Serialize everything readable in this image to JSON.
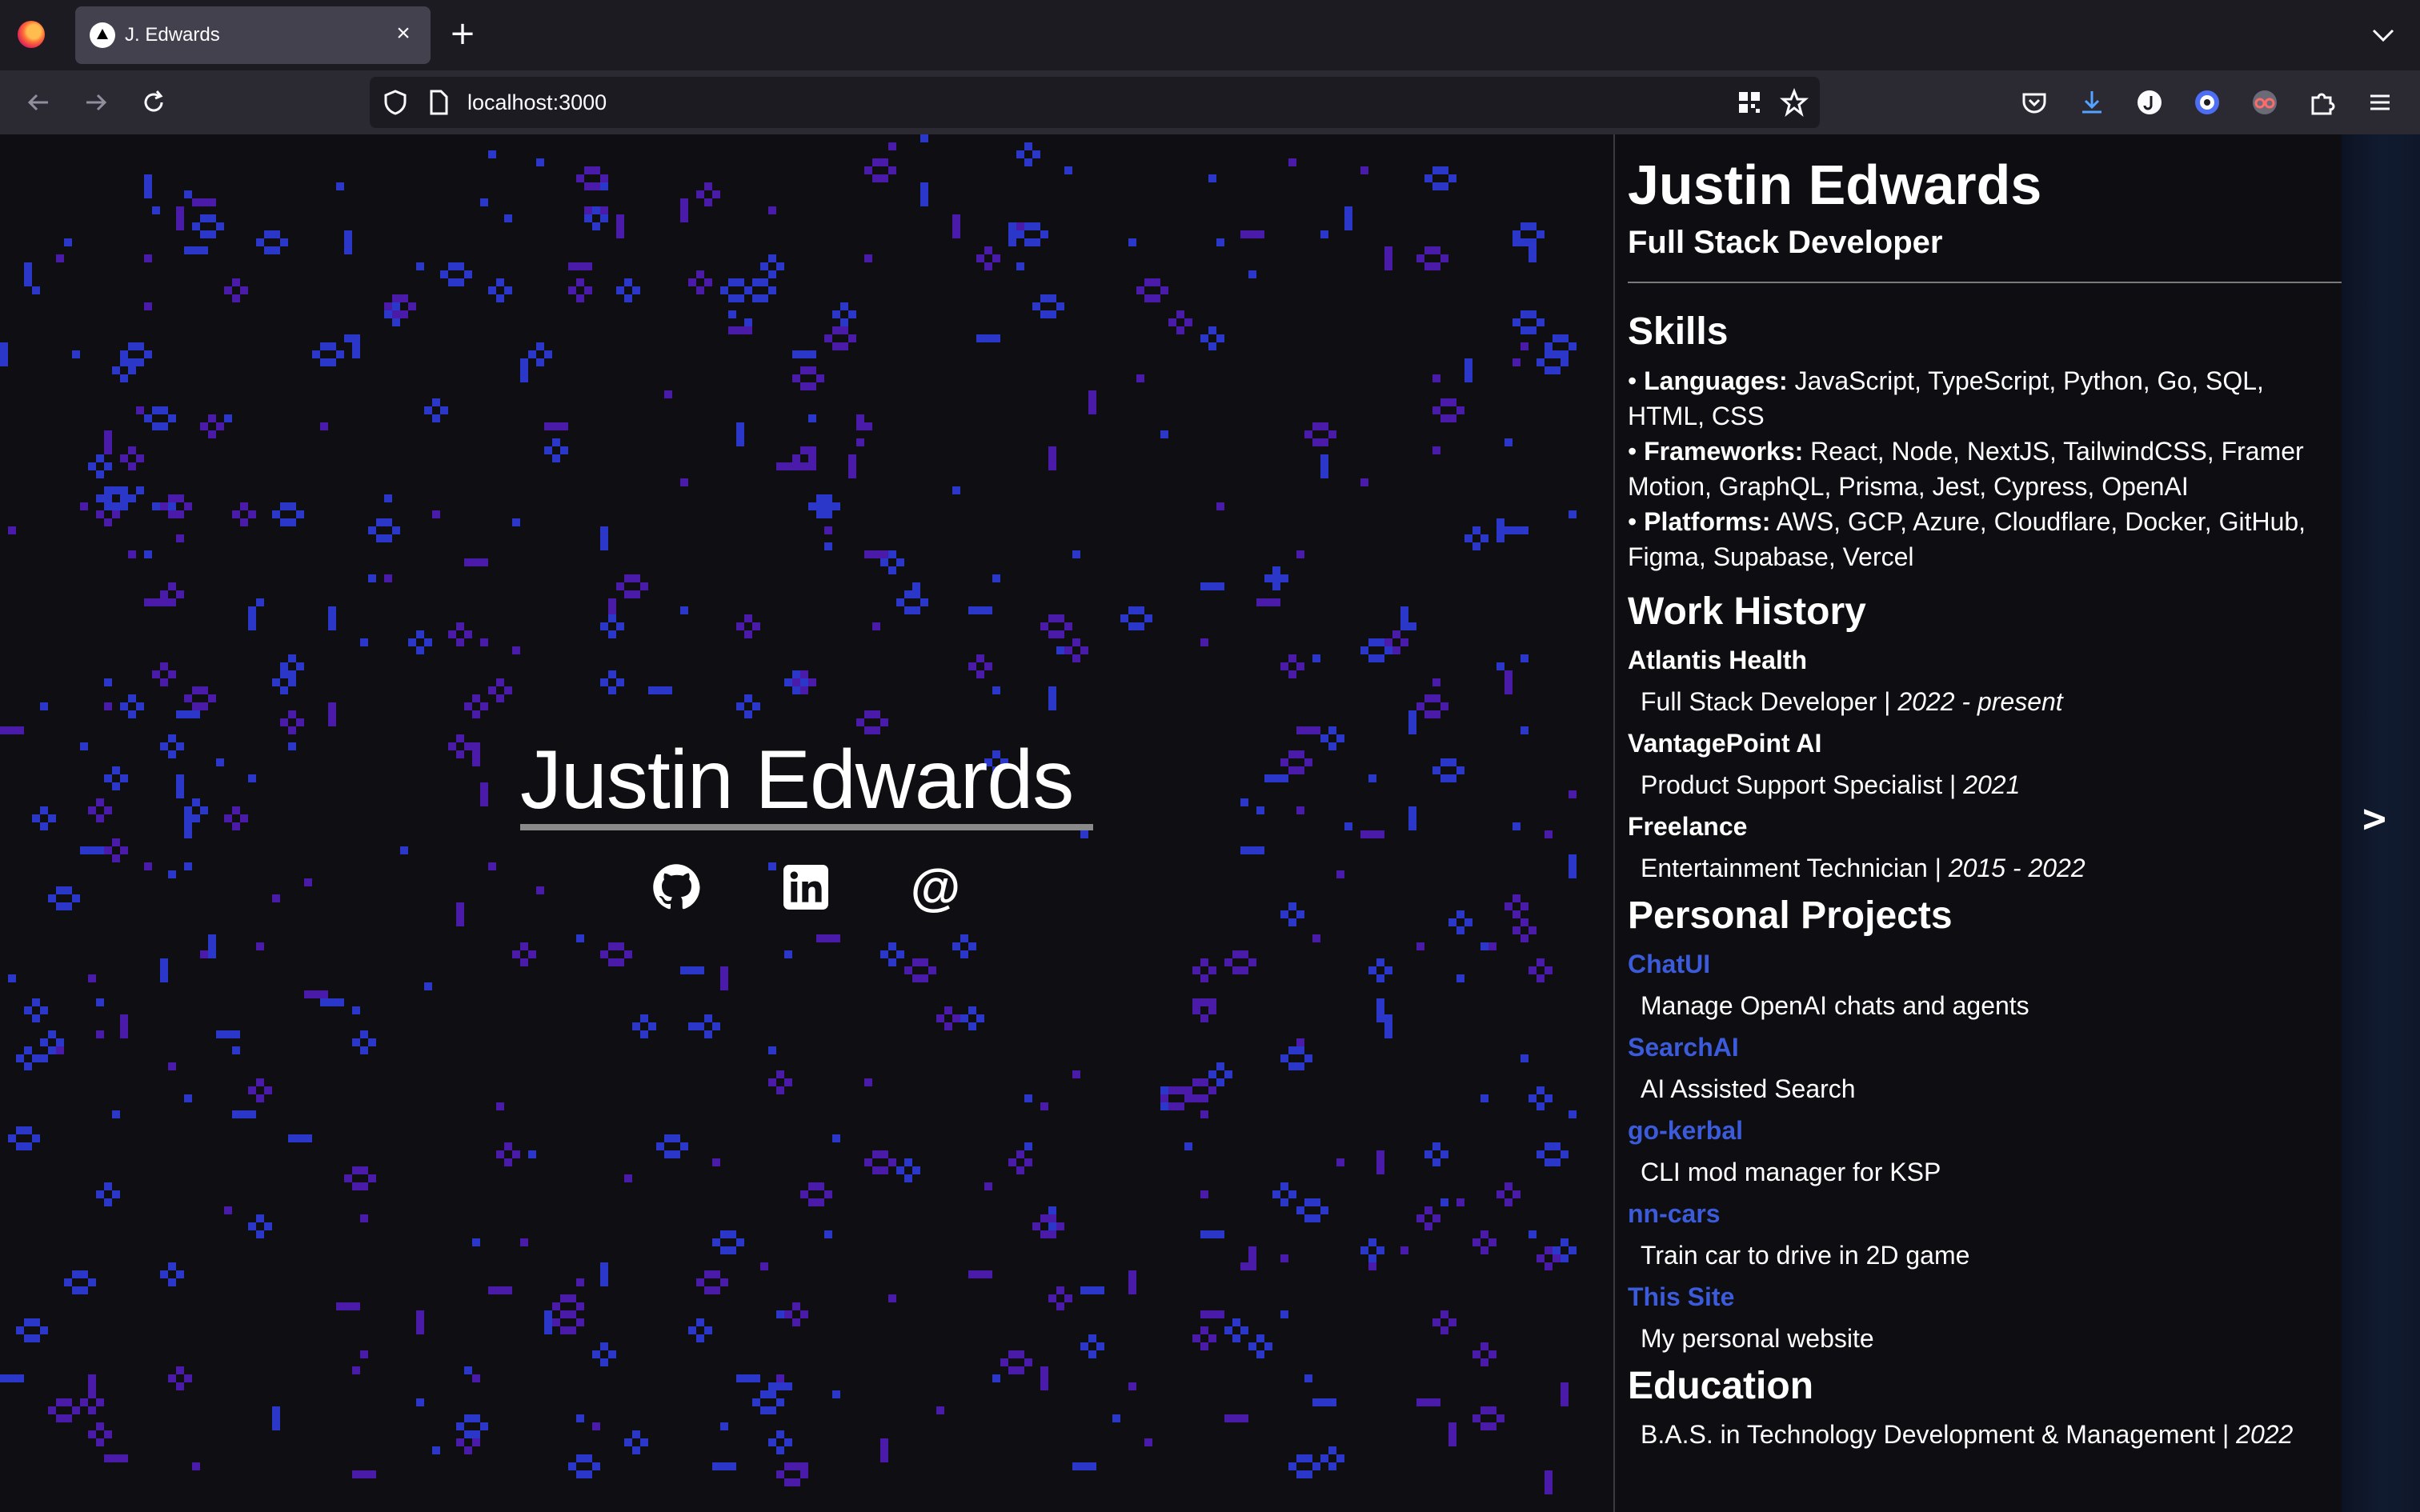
{
  "browser": {
    "tab_title": "J. Edwards",
    "tab_close": "×",
    "new_tab": "+",
    "url": "localhost:3000"
  },
  "hero": {
    "name": "Justin Edwards",
    "social": [
      "github-icon",
      "linkedin-icon",
      "email-at-icon"
    ],
    "at_glyph": "@"
  },
  "resume": {
    "name": "Justin Edwards",
    "title": "Full Stack Developer",
    "skills_heading": "Skills",
    "skills": [
      {
        "bullet": "•",
        "label": "Languages:",
        "text": "JavaScript, TypeScript, Python, Go, SQL, HTML, CSS"
      },
      {
        "bullet": "•",
        "label": "Frameworks:",
        "text": "React, Node, NextJS, TailwindCSS, Framer Motion, GraphQL, Prisma, Jest, Cypress, OpenAI"
      },
      {
        "bullet": "•",
        "label": "Platforms:",
        "text": "AWS, GCP, Azure, Cloudflare, Docker, GitHub, Figma, Supabase, Vercel"
      }
    ],
    "work_heading": "Work History",
    "work": [
      {
        "company": "Atlantis Health",
        "role": "Full Stack Developer | ",
        "dates": "2022 - present"
      },
      {
        "company": "VantagePoint AI",
        "role": "Product Support Specialist | ",
        "dates": "2021"
      },
      {
        "company": "Freelance",
        "role": "Entertainment Technician | ",
        "dates": "2015 - 2022"
      }
    ],
    "projects_heading": "Personal Projects",
    "projects": [
      {
        "name": "ChatUI",
        "desc": "Manage OpenAI chats and agents"
      },
      {
        "name": "SearchAI",
        "desc": "AI Assisted Search"
      },
      {
        "name": "go-kerbal",
        "desc": "CLI mod manager for KSP"
      },
      {
        "name": "nn-cars",
        "desc": "Train car to drive in 2D game"
      },
      {
        "name": "This Site",
        "desc": "My personal website"
      }
    ],
    "education_heading": "Education",
    "education": {
      "degree": "B.A.S. in Technology Development & Management | ",
      "year": "2022"
    }
  },
  "next_arrow": ">",
  "colors": {
    "background": "#0f0e12",
    "cell_blue": "#2a37c8",
    "cell_purple": "#4a1aa8",
    "link_blue": "#3b5bdb"
  }
}
